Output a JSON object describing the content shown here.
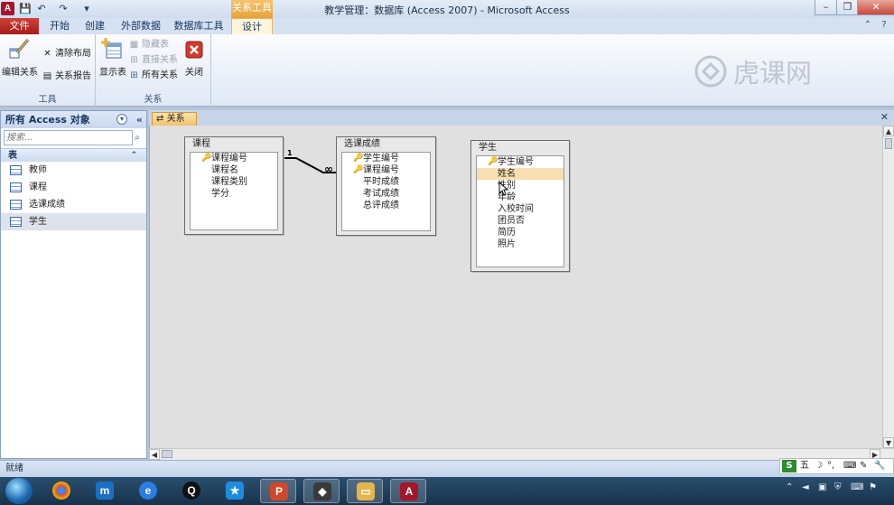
{
  "window": {
    "title": "教学管理：数据库 (Access 2007) - Microsoft Access",
    "context_tab_group": "关系工具",
    "app_icon_letter": "A"
  },
  "quick_access": {
    "save": "💾",
    "undo": "↶",
    "redo": "↷",
    "customize": "▾"
  },
  "ribbon": {
    "tabs": [
      {
        "label": "文件"
      },
      {
        "label": "开始"
      },
      {
        "label": "创建"
      },
      {
        "label": "外部数据"
      },
      {
        "label": "数据库工具"
      },
      {
        "label": "设计"
      }
    ],
    "groups": {
      "tools": {
        "label": "工具",
        "edit_relationships": "编辑关系",
        "clear_layout": "清除布局",
        "relationship_report": "关系报告"
      },
      "relationships": {
        "label": "关系",
        "show_table": "显示表",
        "hide_table": "隐藏表",
        "direct_relationships": "直接关系",
        "all_relationships": "所有关系",
        "close": "关闭"
      }
    }
  },
  "nav": {
    "header": "所有 Access 对象",
    "search_placeholder": "搜索...",
    "group": "表",
    "items": [
      {
        "label": "教师"
      },
      {
        "label": "课程"
      },
      {
        "label": "选课成绩"
      },
      {
        "label": "学生",
        "selected": true
      }
    ]
  },
  "document": {
    "tab_label": "关系",
    "tables": [
      {
        "title": "课程",
        "fields": [
          {
            "name": "课程编号",
            "key": true
          },
          {
            "name": "课程名"
          },
          {
            "name": "课程类别"
          },
          {
            "name": "学分"
          }
        ]
      },
      {
        "title": "选课成绩",
        "fields": [
          {
            "name": "学生编号",
            "key": true
          },
          {
            "name": "课程编号",
            "key": true
          },
          {
            "name": "平时成绩"
          },
          {
            "name": "考试成绩"
          },
          {
            "name": "总评成绩"
          }
        ]
      },
      {
        "title": "学生",
        "fields": [
          {
            "name": "学生编号",
            "key": true
          },
          {
            "name": "姓名",
            "selected": true
          },
          {
            "name": "性别"
          },
          {
            "name": "年龄"
          },
          {
            "name": "入校时间"
          },
          {
            "name": "团员否"
          },
          {
            "name": "简历"
          },
          {
            "name": "照片"
          }
        ]
      }
    ],
    "relationship": {
      "one_label": "1",
      "many_label": "∞"
    }
  },
  "status": {
    "text": "就绪"
  },
  "ime": {
    "logo": "S",
    "mode": "五",
    "moon": "☽",
    "punct": "°,",
    "keyboard": "⌨",
    "tools": "✎",
    "settings": "🔧"
  },
  "taskbar": {
    "apps": [
      "chrome",
      "maxthon",
      "browser",
      "qq",
      "assistant",
      "powerpoint",
      "media",
      "explorer",
      "access"
    ]
  },
  "watermark": {
    "text": "虎课网"
  },
  "colors": {
    "accent": "#1d3f6e",
    "file_tab": "#b8261f",
    "context_tab": "#e6a23c",
    "selected_field": "#f9deb0"
  }
}
